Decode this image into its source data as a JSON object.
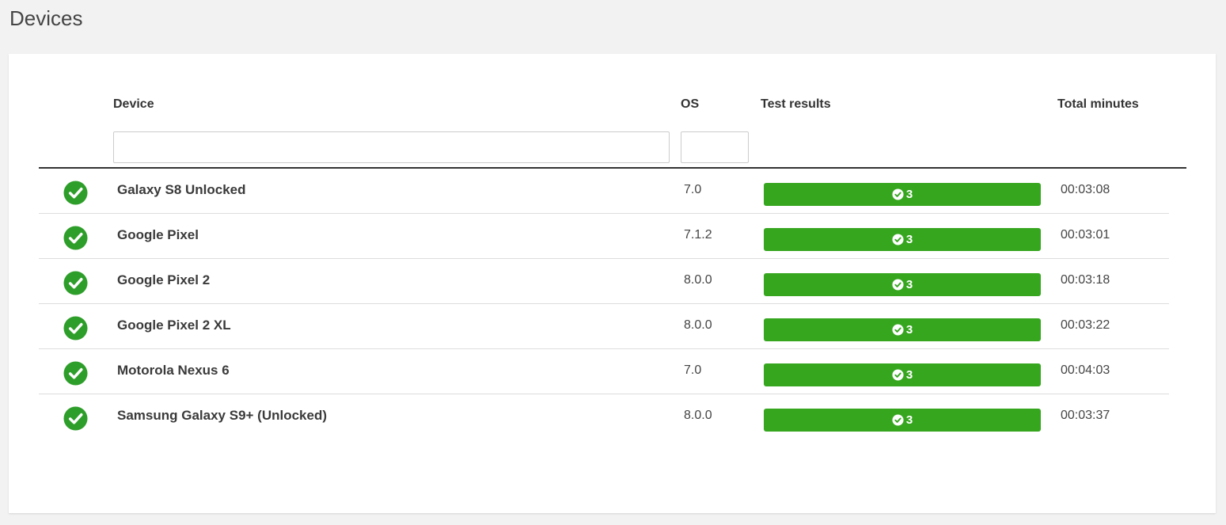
{
  "page": {
    "title": "Devices"
  },
  "table": {
    "headers": {
      "device": "Device",
      "os": "OS",
      "test_results": "Test results",
      "total_minutes": "Total minutes"
    },
    "filters": {
      "device_value": "",
      "os_value": ""
    },
    "rows": [
      {
        "status": "passed",
        "device": "Galaxy S8 Unlocked",
        "os": "7.0",
        "passed_count": "3",
        "total_minutes": "00:03:08"
      },
      {
        "status": "passed",
        "device": "Google Pixel",
        "os": "7.1.2",
        "passed_count": "3",
        "total_minutes": "00:03:01"
      },
      {
        "status": "passed",
        "device": "Google Pixel 2",
        "os": "8.0.0",
        "passed_count": "3",
        "total_minutes": "00:03:18"
      },
      {
        "status": "passed",
        "device": "Google Pixel 2 XL",
        "os": "8.0.0",
        "passed_count": "3",
        "total_minutes": "00:03:22"
      },
      {
        "status": "passed",
        "device": "Motorola Nexus 6",
        "os": "7.0",
        "passed_count": "3",
        "total_minutes": "00:04:03"
      },
      {
        "status": "passed",
        "device": "Samsung Galaxy S9+ (Unlocked)",
        "os": "8.0.0",
        "passed_count": "3",
        "total_minutes": "00:03:37"
      }
    ]
  },
  "colors": {
    "pass_green": "#36a61f",
    "icon_green": "#2e9e2a"
  },
  "icons": {
    "row_status": "check-circle-icon",
    "result_badge": "check-circle-icon"
  }
}
